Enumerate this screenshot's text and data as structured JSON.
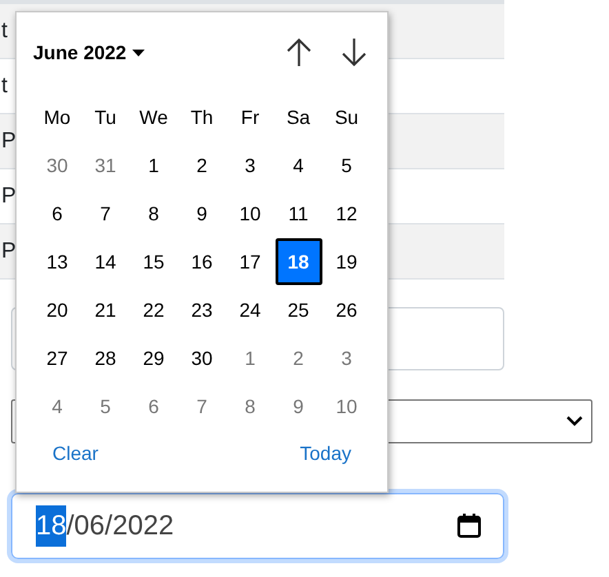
{
  "table": {
    "rows": [
      {
        "cell": "t"
      },
      {
        "cell": "t"
      },
      {
        "cell": "P"
      },
      {
        "cell": "P"
      },
      {
        "cell": "P"
      }
    ]
  },
  "date_input": {
    "segments": [
      {
        "text": "18",
        "selected": true
      },
      {
        "text": "/06/2022",
        "selected": false
      }
    ]
  },
  "datepicker": {
    "month_label": "June 2022",
    "weekdays": [
      "Mo",
      "Tu",
      "We",
      "Th",
      "Fr",
      "Sa",
      "Su"
    ],
    "days": [
      {
        "label": "30",
        "outside": true,
        "selected": false
      },
      {
        "label": "31",
        "outside": true,
        "selected": false
      },
      {
        "label": "1",
        "outside": false,
        "selected": false
      },
      {
        "label": "2",
        "outside": false,
        "selected": false
      },
      {
        "label": "3",
        "outside": false,
        "selected": false
      },
      {
        "label": "4",
        "outside": false,
        "selected": false
      },
      {
        "label": "5",
        "outside": false,
        "selected": false
      },
      {
        "label": "6",
        "outside": false,
        "selected": false
      },
      {
        "label": "7",
        "outside": false,
        "selected": false
      },
      {
        "label": "8",
        "outside": false,
        "selected": false
      },
      {
        "label": "9",
        "outside": false,
        "selected": false
      },
      {
        "label": "10",
        "outside": false,
        "selected": false
      },
      {
        "label": "11",
        "outside": false,
        "selected": false
      },
      {
        "label": "12",
        "outside": false,
        "selected": false
      },
      {
        "label": "13",
        "outside": false,
        "selected": false
      },
      {
        "label": "14",
        "outside": false,
        "selected": false
      },
      {
        "label": "15",
        "outside": false,
        "selected": false
      },
      {
        "label": "16",
        "outside": false,
        "selected": false
      },
      {
        "label": "17",
        "outside": false,
        "selected": false
      },
      {
        "label": "18",
        "outside": false,
        "selected": true
      },
      {
        "label": "19",
        "outside": false,
        "selected": false
      },
      {
        "label": "20",
        "outside": false,
        "selected": false
      },
      {
        "label": "21",
        "outside": false,
        "selected": false
      },
      {
        "label": "22",
        "outside": false,
        "selected": false
      },
      {
        "label": "23",
        "outside": false,
        "selected": false
      },
      {
        "label": "24",
        "outside": false,
        "selected": false
      },
      {
        "label": "25",
        "outside": false,
        "selected": false
      },
      {
        "label": "26",
        "outside": false,
        "selected": false
      },
      {
        "label": "27",
        "outside": false,
        "selected": false
      },
      {
        "label": "28",
        "outside": false,
        "selected": false
      },
      {
        "label": "29",
        "outside": false,
        "selected": false
      },
      {
        "label": "30",
        "outside": false,
        "selected": false
      },
      {
        "label": "1",
        "outside": true,
        "selected": false
      },
      {
        "label": "2",
        "outside": true,
        "selected": false
      },
      {
        "label": "3",
        "outside": true,
        "selected": false
      },
      {
        "label": "4",
        "outside": true,
        "selected": false
      },
      {
        "label": "5",
        "outside": true,
        "selected": false
      },
      {
        "label": "6",
        "outside": true,
        "selected": false
      },
      {
        "label": "7",
        "outside": true,
        "selected": false
      },
      {
        "label": "8",
        "outside": true,
        "selected": false
      },
      {
        "label": "9",
        "outside": true,
        "selected": false
      },
      {
        "label": "10",
        "outside": true,
        "selected": false
      }
    ],
    "clear_label": "Clear",
    "today_label": "Today"
  }
}
